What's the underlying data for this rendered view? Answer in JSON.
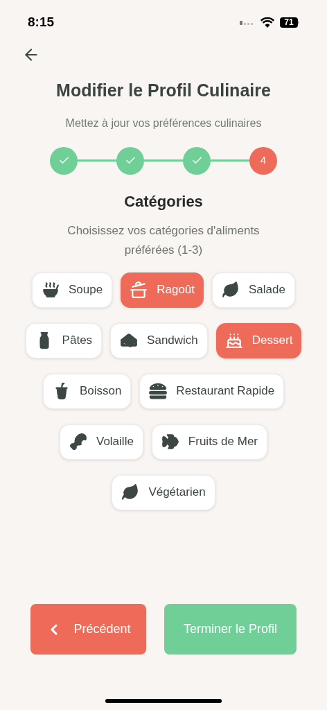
{
  "status_bar": {
    "time": "8:15",
    "battery": "71"
  },
  "title": "Modifier le Profil Culinaire",
  "subtitle": "Mettez à jour vos préférences culinaires",
  "steps": [
    {
      "done": true
    },
    {
      "done": true
    },
    {
      "done": true
    },
    {
      "done": false,
      "label": "4"
    }
  ],
  "section": {
    "title": "Catégories",
    "description": "Choisissez vos catégories d'aliments préférées (1-3)"
  },
  "category_rows": [
    [
      {
        "label": "Soupe",
        "selected": false
      },
      {
        "label": "Ragoût",
        "selected": true
      },
      {
        "label": "Salade",
        "selected": false
      }
    ],
    [
      {
        "label": "Pâtes",
        "selected": false
      },
      {
        "label": "Sandwich",
        "selected": false
      },
      {
        "label": "Dessert",
        "selected": true
      }
    ],
    [
      {
        "label": "Boisson",
        "selected": false
      },
      {
        "label": "Restaurant Rapide",
        "selected": false
      }
    ],
    [
      {
        "label": "Volaille",
        "selected": false
      },
      {
        "label": "Fruits de Mer",
        "selected": false
      }
    ],
    [
      {
        "label": "Végétarien",
        "selected": false
      }
    ]
  ],
  "buttons": {
    "previous": "Précédent",
    "finish": "Terminer le Profil"
  }
}
